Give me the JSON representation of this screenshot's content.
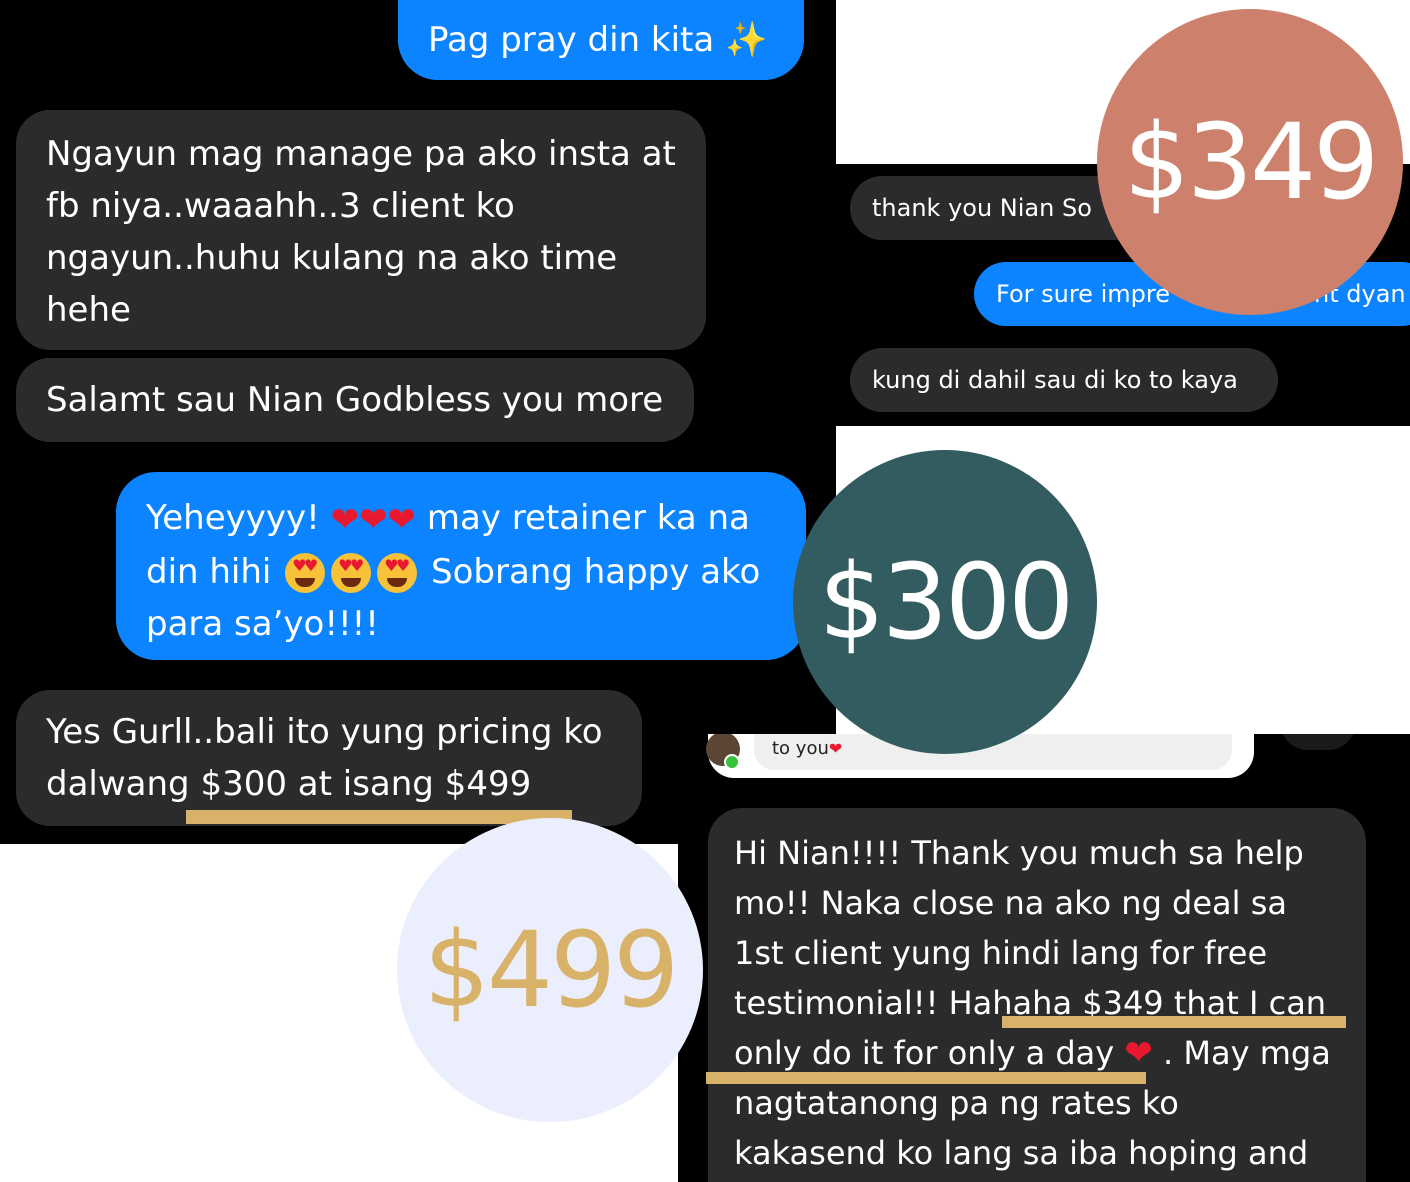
{
  "left_chat": {
    "msg_pray": "Pag pray din kita ✨",
    "msg_manage": "Ngayun mag manage pa ako insta at fb niya..waaahh..3 client ko ngayun..huhu kulang na ako time hehe",
    "msg_salamat": "Salamt sau Nian Godbless you more",
    "msg_yehey_a": "Yeheyyyy!",
    "msg_yehey_b": "may retainer ka na din hihi",
    "msg_yehey_c": "Sobrang happy ako para sa’yo!!!!",
    "msg_pricing_a": "Yes Gurll..bali ito yung pricing ko",
    "msg_pricing_b": "dalwang $300 at isang $499"
  },
  "right_chat": {
    "msg_thank": "thank you Nian So",
    "msg_forsure": "For sure impre",
    "msg_forsure_tail": "nt dyan",
    "msg_kung": "kung di dahil sau di ko to kaya"
  },
  "bottom_chat": {
    "reply_snippet": "to you",
    "msg_hi": "Hi Nian!!!! Thank you much sa help mo!! Naka close na ako ng deal sa 1st client yung hindi lang for free testimonial!! Hahaha $349 that I can only do it for only a day",
    "msg_hi_tail": ". May mga nagtatanong pa ng rates ko kakasend ko lang sa iba hoping and"
  },
  "badges": {
    "price_349": "$349",
    "price_300": "$300",
    "price_499": "$499"
  },
  "colors": {
    "blue_bubble": "#0d84ff",
    "gray_bubble": "#2b2b2d",
    "highlight": "#d9b26a",
    "badge_349": "#cd806b",
    "badge_300": "#325c60",
    "badge_499": "#ebeefc"
  }
}
